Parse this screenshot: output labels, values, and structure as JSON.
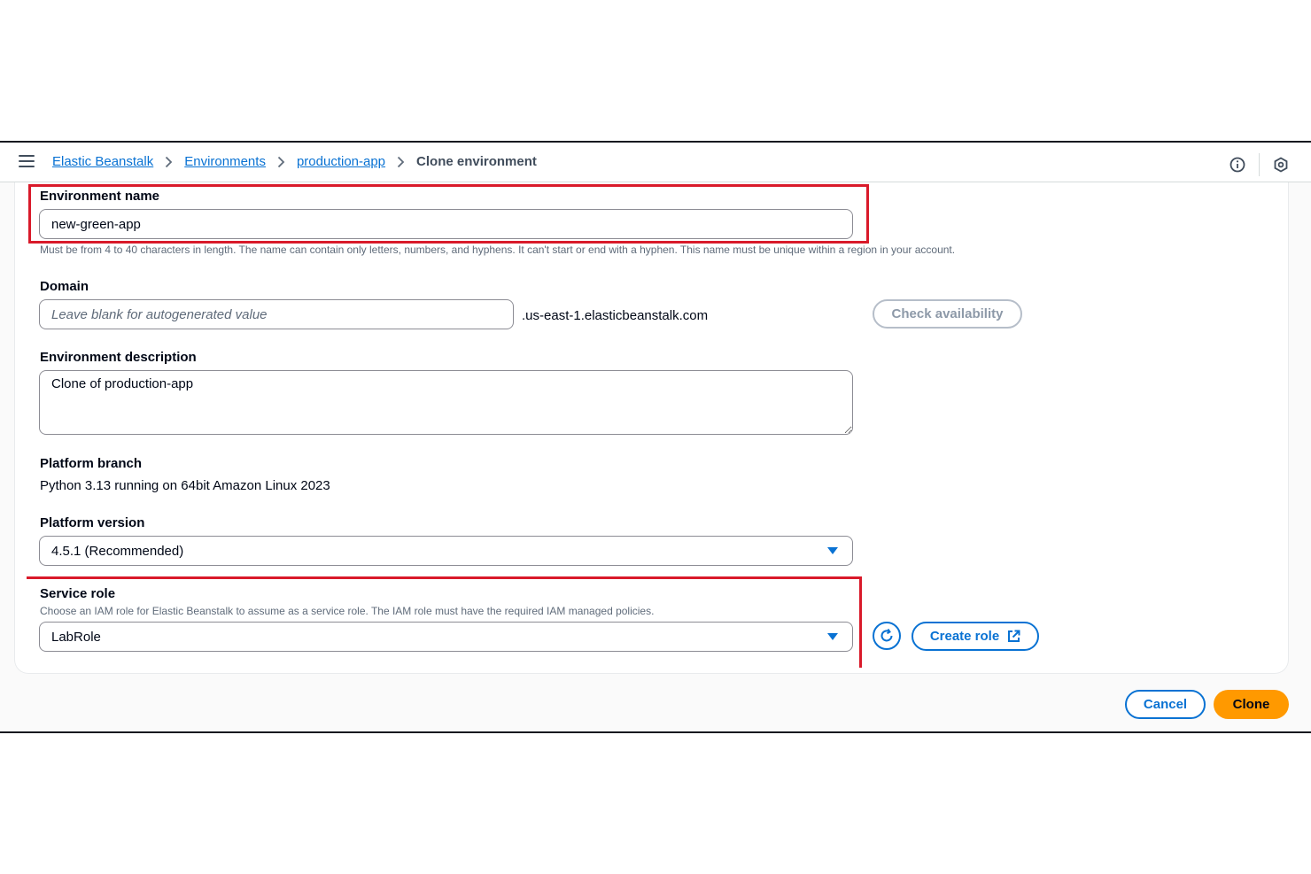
{
  "breadcrumbs": {
    "items": [
      "Elastic Beanstalk",
      "Environments",
      "production-app"
    ],
    "current": "Clone environment"
  },
  "icons": {
    "menu": "hamburger-menu-icon",
    "info": "info-icon",
    "settings": "hexagon-settings-icon",
    "refresh": "refresh-icon",
    "external": "external-link-icon"
  },
  "form": {
    "environment_name": {
      "label": "Environment name",
      "value": "new-green-app",
      "hint": "Must be from 4 to 40 characters in length. The name can contain only letters, numbers, and hyphens. It can't start or end with a hyphen. This name must be unique within a region in your account."
    },
    "domain": {
      "label": "Domain",
      "placeholder": "Leave blank for autogenerated value",
      "suffix": ".us-east-1.elasticbeanstalk.com",
      "check_button": "Check availability"
    },
    "environment_description": {
      "label": "Environment description",
      "value": "Clone of production-app"
    },
    "platform_branch": {
      "label": "Platform branch",
      "value": "Python 3.13 running on 64bit Amazon Linux 2023"
    },
    "platform_version": {
      "label": "Platform version",
      "selected": "4.5.1 (Recommended)"
    },
    "service_role": {
      "label": "Service role",
      "hint": "Choose an IAM role for Elastic Beanstalk to assume as a service role. The IAM role must have the required IAM managed policies.",
      "selected": "LabRole",
      "create_button": "Create role"
    }
  },
  "footer": {
    "cancel": "Cancel",
    "clone": "Clone"
  },
  "colors": {
    "link": "#0972d3",
    "primary": "#ff9900",
    "highlight": "#d91a2a"
  }
}
